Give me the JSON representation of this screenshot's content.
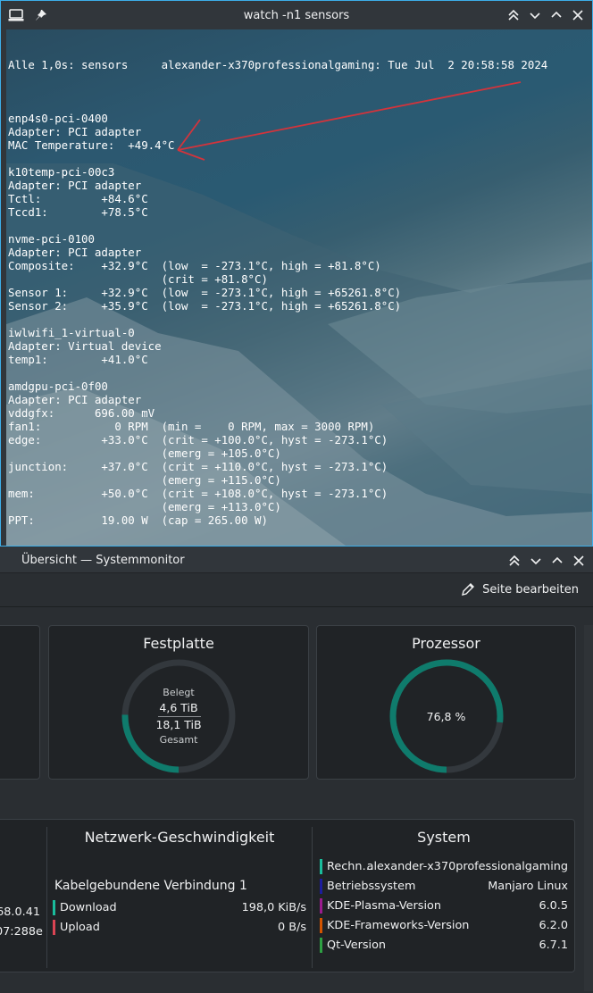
{
  "terminal": {
    "title": "watch -n1 sensors",
    "header_left": "Alle 1,0s: sensors",
    "header_right": "alexander-x370professionalgaming: Tue Jul  2 20:58:58 2024",
    "lines": [
      "",
      "enp4s0-pci-0400",
      "Adapter: PCI adapter",
      "MAC Temperature:  +49.4°C",
      "",
      "k10temp-pci-00c3",
      "Adapter: PCI adapter",
      "Tctl:         +84.6°C",
      "Tccd1:        +78.5°C",
      "",
      "nvme-pci-0100",
      "Adapter: PCI adapter",
      "Composite:    +32.9°C  (low  = -273.1°C, high = +81.8°C)",
      "                       (crit = +81.8°C)",
      "Sensor 1:     +32.9°C  (low  = -273.1°C, high = +65261.8°C)",
      "Sensor 2:     +35.9°C  (low  = -273.1°C, high = +65261.8°C)",
      "",
      "iwlwifi_1-virtual-0",
      "Adapter: Virtual device",
      "temp1:        +41.0°C",
      "",
      "amdgpu-pci-0f00",
      "Adapter: PCI adapter",
      "vddgfx:      696.00 mV",
      "fan1:           0 RPM  (min =    0 RPM, max = 3000 RPM)",
      "edge:         +33.0°C  (crit = +100.0°C, hyst = -273.1°C)",
      "                       (emerg = +105.0°C)",
      "junction:     +37.0°C  (crit = +110.0°C, hyst = -273.1°C)",
      "                       (emerg = +115.0°C)",
      "mem:          +50.0°C  (crit = +108.0°C, hyst = -273.1°C)",
      "                       (emerg = +113.0°C)",
      "PPT:          19.00 W  (cap = 265.00 W)"
    ]
  },
  "sysmon": {
    "title": "Übersicht — Systemmonitor",
    "edit_label": "Seite bearbeiten",
    "disk": {
      "title": "Festplatte",
      "used_label": "Belegt",
      "used_value": "4,6 TiB",
      "total_value": "18,1 TiB",
      "total_label": "Gesamt",
      "fraction": 0.254
    },
    "cpu": {
      "title": "Prozessor",
      "value_text": "76,8 %",
      "fraction": 0.768
    },
    "network": {
      "title": "Netzwerk-Geschwindigkeit",
      "connection": "Kabelgebundene Verbindung 1",
      "rows": [
        {
          "label": "Download",
          "value": "198,0 KiB/s",
          "color": "#1abc9c"
        },
        {
          "label": "Upload",
          "value": "0 B/s",
          "color": "#da4453"
        }
      ]
    },
    "left_partial": {
      "line1": "68.0.41",
      "line2": "07:288e"
    },
    "system": {
      "title": "System",
      "rows": [
        {
          "label": "Rechn…",
          "value": "alexander-x370professionalgaming",
          "color": "#1abc9c"
        },
        {
          "label": "Betriebssystem",
          "value": "Manjaro Linux",
          "color": "#1d1d9e"
        },
        {
          "label": "KDE-Plasma-Version",
          "value": "6.0.5",
          "color": "#9b1b8e"
        },
        {
          "label": "KDE-Frameworks-Version",
          "value": "6.2.0",
          "color": "#d35400"
        },
        {
          "label": "Qt-Version",
          "value": "6.7.1",
          "color": "#2ea043"
        }
      ]
    },
    "colors": {
      "accent": "#0f7b6c",
      "track": "#33383d"
    }
  }
}
